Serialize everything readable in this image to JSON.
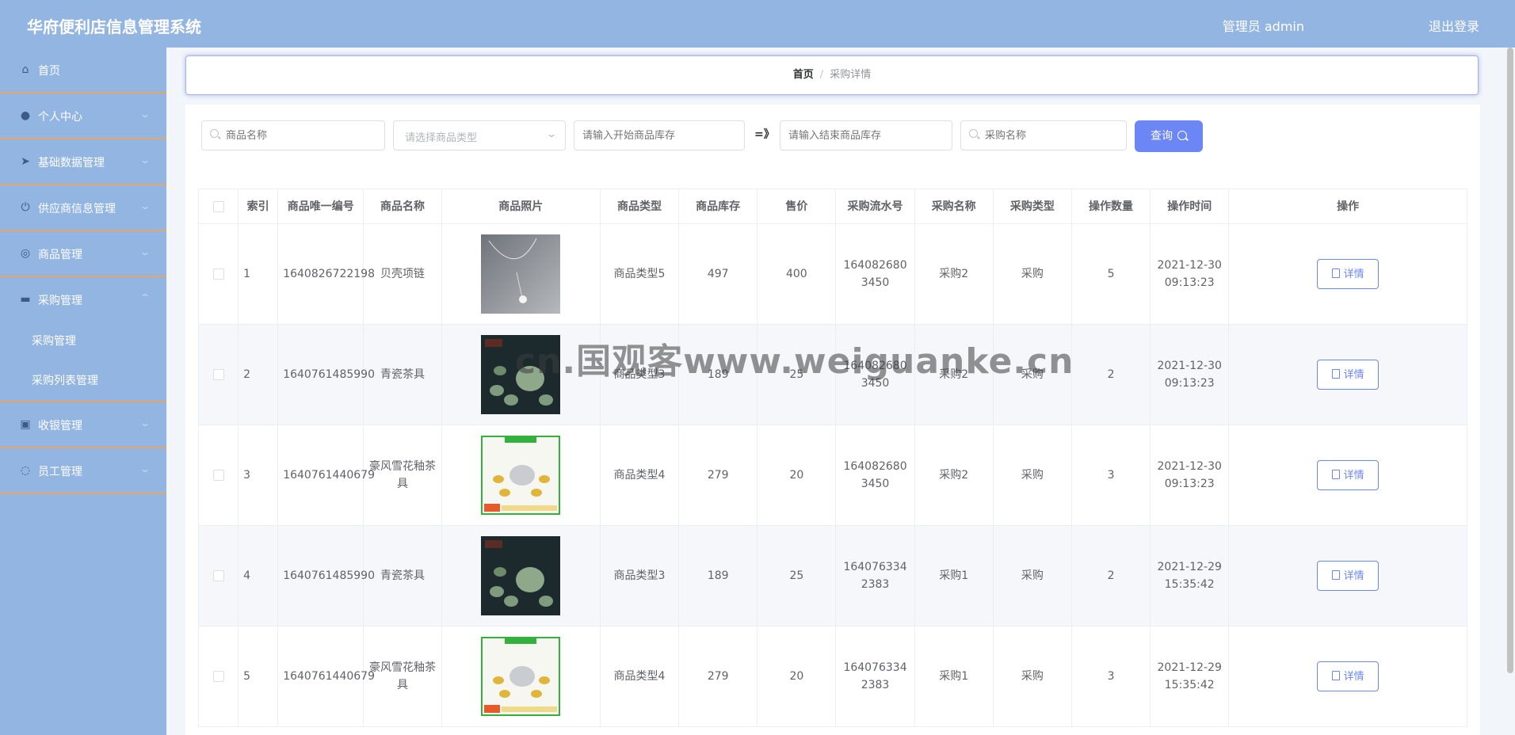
{
  "header": {
    "title": "华府便利店信息管理系统",
    "admin": "管理员 admin",
    "logout": "退出登录"
  },
  "sidebar": {
    "items": [
      {
        "label": "首页",
        "icon": "home-icon"
      },
      {
        "label": "个人中心",
        "icon": "user-icon"
      },
      {
        "label": "基础数据管理",
        "icon": "send-icon"
      },
      {
        "label": "供应商信息管理",
        "icon": "power-icon"
      },
      {
        "label": "商品管理",
        "icon": "compass-icon"
      },
      {
        "label": "采购管理",
        "icon": "chat-icon"
      },
      {
        "label": "收银管理",
        "icon": "clipboard-icon"
      },
      {
        "label": "员工管理",
        "icon": "globe-icon"
      }
    ],
    "submenu": [
      "采购管理",
      "采购列表管理"
    ]
  },
  "breadcrumb": {
    "home": "首页",
    "current": "采购详情"
  },
  "search": {
    "product_name_placeholder": "商品名称",
    "product_type_placeholder": "请选择商品类型",
    "stock_start_placeholder": "请输入开始商品库存",
    "range_sep": "=》",
    "stock_end_placeholder": "请输入结束商品库存",
    "purchase_name_placeholder": "采购名称",
    "query_label": "查询"
  },
  "table": {
    "headers": [
      "索引",
      "商品唯一编号",
      "商品名称",
      "商品照片",
      "商品类型",
      "商品库存",
      "售价",
      "采购流水号",
      "采购名称",
      "采购类型",
      "操作数量",
      "操作时间",
      "操作"
    ],
    "detail_label": "详情",
    "rows": [
      {
        "index": "1",
        "code": "1640826722198",
        "name": "贝壳项链",
        "photo": "necklace",
        "type": "商品类型5",
        "stock": "497",
        "price": "400",
        "serial": "1640826803450",
        "purchase_name": "采购2",
        "purchase_type": "采购",
        "qty": "5",
        "time": "2021-12-30 09:13:23"
      },
      {
        "index": "2",
        "code": "1640761485990",
        "name": "青瓷茶具",
        "photo": "tea-set-dark",
        "type": "商品类型3",
        "stock": "189",
        "price": "25",
        "serial": "1640826803450",
        "purchase_name": "采购2",
        "purchase_type": "采购",
        "qty": "2",
        "time": "2021-12-30 09:13:23"
      },
      {
        "index": "3",
        "code": "1640761440679",
        "name": "豪风雪花釉茶具",
        "photo": "tea-set-green",
        "type": "商品类型4",
        "stock": "279",
        "price": "20",
        "serial": "1640826803450",
        "purchase_name": "采购2",
        "purchase_type": "采购",
        "qty": "3",
        "time": "2021-12-30 09:13:23"
      },
      {
        "index": "4",
        "code": "1640761485990",
        "name": "青瓷茶具",
        "photo": "tea-set-dark",
        "type": "商品类型3",
        "stock": "189",
        "price": "25",
        "serial": "1640763342383",
        "purchase_name": "采购1",
        "purchase_type": "采购",
        "qty": "2",
        "time": "2021-12-29 15:35:42"
      },
      {
        "index": "5",
        "code": "1640761440679",
        "name": "豪风雪花釉茶具",
        "photo": "tea-set-green",
        "type": "商品类型4",
        "stock": "279",
        "price": "20",
        "serial": "1640763342383",
        "purchase_name": "采购1",
        "purchase_type": "采购",
        "qty": "3",
        "time": "2021-12-29 15:35:42"
      }
    ]
  },
  "watermark": "cn.国观客www.weiguanke.cn"
}
